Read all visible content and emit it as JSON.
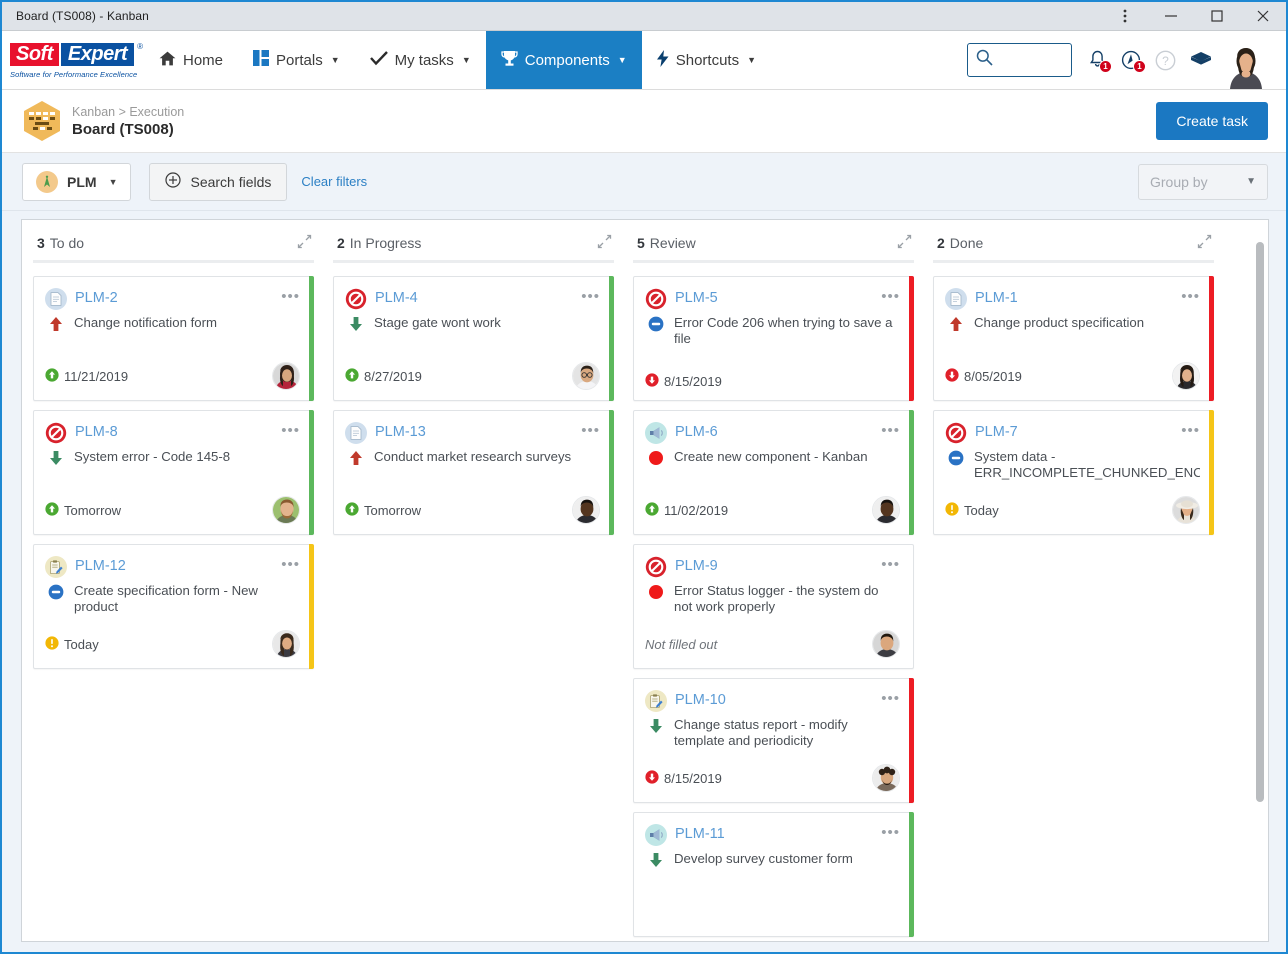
{
  "window": {
    "title": "Board (TS008) - Kanban",
    "controls": {
      "menu": "⋮",
      "minimize": "—",
      "maximize": "□",
      "close": "✕"
    }
  },
  "navbar": {
    "brand": {
      "soft": "Soft",
      "expert": "Expert",
      "registered": "®",
      "tagline": "Software for Performance Excellence"
    },
    "items": [
      {
        "label": "Home",
        "icon": "home-icon",
        "has_caret": false,
        "active": false
      },
      {
        "label": "Portals",
        "icon": "portals-icon",
        "has_caret": true,
        "active": false
      },
      {
        "label": "My tasks",
        "icon": "check-icon",
        "has_caret": true,
        "active": false
      },
      {
        "label": "Components",
        "icon": "trophy-icon",
        "has_caret": true,
        "active": true
      },
      {
        "label": "Shortcuts",
        "icon": "bolt-icon",
        "has_caret": true,
        "active": false
      }
    ],
    "search": {
      "value": "",
      "placeholder": ""
    },
    "icons": [
      {
        "name": "notifications-bell-icon",
        "badge": "1"
      },
      {
        "name": "alerts-clock-icon",
        "badge": "1"
      },
      {
        "name": "help-icon",
        "badge": ""
      },
      {
        "name": "academy-icon",
        "badge": ""
      }
    ]
  },
  "header": {
    "breadcrumb": "Kanban > Execution",
    "title": "Board (TS008)",
    "create_button": "Create task"
  },
  "filterbar": {
    "project": "PLM",
    "search_fields": "Search fields",
    "clear_filters": "Clear filters",
    "group_by_placeholder": "Group by"
  },
  "colors": {
    "accent_green": "#5cb85c",
    "accent_red": "#ed1c24",
    "accent_yellow": "#f5c517",
    "brand_blue": "#1b78c2",
    "link_blue": "#5b9bd5"
  },
  "board": {
    "columns": [
      {
        "count": "3",
        "name": "To do",
        "cards": [
          {
            "id": "PLM-2",
            "type_icon": "document-icon",
            "title": "Change notification form",
            "priority_icon": "arrow-up-red",
            "due": "11/21/2019",
            "due_state": "ontime",
            "accent": "green",
            "avatar": "woman-dark-hair",
            "has_avatar": true
          },
          {
            "id": "PLM-8",
            "type_icon": "problem-icon",
            "title": "System error - Code 145-8",
            "priority_icon": "arrow-down-green",
            "due": "Tomorrow",
            "due_state": "ontime",
            "accent": "green",
            "avatar": "man-beard",
            "has_avatar": true
          },
          {
            "id": "PLM-12",
            "type_icon": "clipboard-icon",
            "title": "Create specification form - New product",
            "priority_icon": "minus-blue",
            "due": "Today",
            "due_state": "warning",
            "accent": "yellow",
            "avatar": "woman-long-hair",
            "has_avatar": true
          }
        ]
      },
      {
        "count": "2",
        "name": "In Progress",
        "cards": [
          {
            "id": "PLM-4",
            "type_icon": "problem-icon",
            "title": "Stage gate wont work",
            "priority_icon": "arrow-down-green",
            "due": "8/27/2019",
            "due_state": "ontime",
            "accent": "green",
            "avatar": "man-glasses",
            "has_avatar": true
          },
          {
            "id": "PLM-13",
            "type_icon": "document-icon",
            "title": "Conduct market research surveys",
            "priority_icon": "arrow-up-red",
            "due": "Tomorrow",
            "due_state": "ontime",
            "accent": "green",
            "avatar": "man-dark-skin",
            "has_avatar": true
          }
        ]
      },
      {
        "count": "5",
        "name": "Review",
        "cards": [
          {
            "id": "PLM-5",
            "type_icon": "problem-icon",
            "title": "Error Code 206 when trying to save a file",
            "priority_icon": "minus-blue",
            "due": "8/15/2019",
            "due_state": "late",
            "accent": "red",
            "avatar": "",
            "has_avatar": false
          },
          {
            "id": "PLM-6",
            "type_icon": "announcement-icon",
            "title": "Create new component - Kanban",
            "priority_icon": "circle-red",
            "due": "11/02/2019",
            "due_state": "ontime",
            "accent": "green",
            "avatar": "man-dark-skin",
            "has_avatar": true
          },
          {
            "id": "PLM-9",
            "type_icon": "problem-icon",
            "title": "Error Status logger - the system do not work properly",
            "priority_icon": "circle-red",
            "due": "Not filled out",
            "due_state": "none",
            "accent": "none",
            "avatar": "man-short-hair",
            "has_avatar": true
          },
          {
            "id": "PLM-10",
            "type_icon": "clipboard-icon",
            "title": "Change status report - modify template and periodicity",
            "priority_icon": "arrow-down-green",
            "due": "8/15/2019",
            "due_state": "late",
            "accent": "red",
            "avatar": "man-curly",
            "has_avatar": true
          },
          {
            "id": "PLM-11",
            "type_icon": "announcement-icon",
            "title": "Develop survey customer form",
            "priority_icon": "arrow-down-green",
            "due": "",
            "due_state": "none",
            "accent": "green",
            "avatar": "",
            "has_avatar": false
          }
        ]
      },
      {
        "count": "2",
        "name": "Done",
        "cards": [
          {
            "id": "PLM-1",
            "type_icon": "document-icon",
            "title": "Change product specification",
            "priority_icon": "arrow-up-red",
            "due": "8/05/2019",
            "due_state": "late",
            "accent": "red",
            "avatar": "woman-dark-hair2",
            "has_avatar": true
          },
          {
            "id": "PLM-7",
            "type_icon": "problem-icon",
            "title": "System data - ERR_INCOMPLETE_CHUNKED_ENCODI",
            "priority_icon": "minus-blue",
            "due": "Today",
            "due_state": "warning",
            "accent": "yellow",
            "avatar": "woman-hat",
            "has_avatar": true
          }
        ]
      }
    ]
  }
}
